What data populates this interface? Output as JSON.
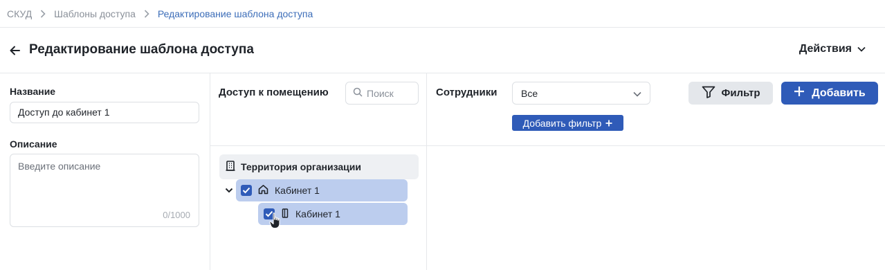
{
  "breadcrumb": {
    "items": [
      "СКУД",
      "Шаблоны доступа",
      "Редактирование шаблона доступа"
    ]
  },
  "header": {
    "title": "Редактирование шаблона доступа",
    "actions_label": "Действия"
  },
  "form": {
    "name_label": "Название",
    "name_value": "Доступ до кабинет 1",
    "description_label": "Описание",
    "description_placeholder": "Введите описание",
    "description_counter": "0/1000"
  },
  "access": {
    "title": "Доступ к помещению",
    "search_placeholder": "Поиск",
    "tree": {
      "root_label": "Территория организации",
      "level1": {
        "label": "Кабинет 1",
        "checked": true,
        "expanded": true
      },
      "level2": {
        "label": "Кабинет 1",
        "checked": true
      }
    }
  },
  "employees": {
    "title": "Сотрудники",
    "select_value": "Все",
    "add_filter_label": "Добавить фильтр",
    "filter_button": "Фильтр",
    "add_button": "Добавить"
  },
  "colors": {
    "accent": "#2f5bb8",
    "selected_row": "#bccdee",
    "link": "#3c6db8"
  }
}
